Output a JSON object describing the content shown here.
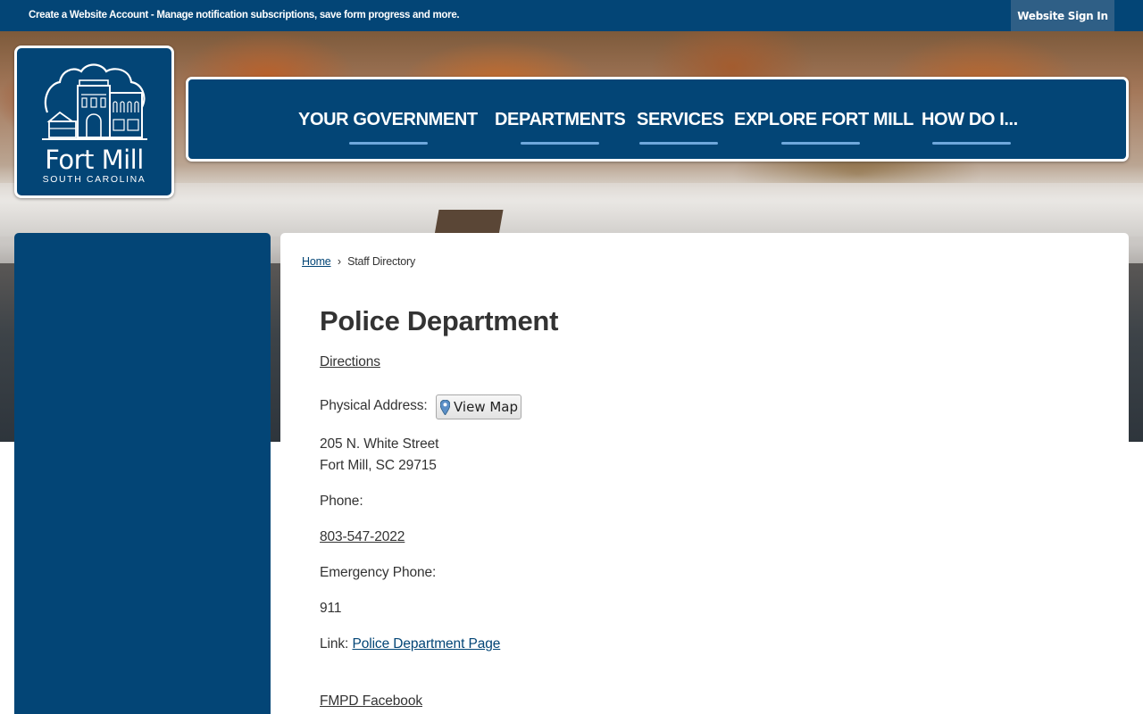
{
  "topbar": {
    "message": "Create a Website Account - Manage notification subscriptions, save form progress and more.",
    "signin_label": "Website Sign In"
  },
  "logo": {
    "name": "Fort Mill",
    "subtitle": "SOUTH CAROLINA"
  },
  "nav": {
    "items": [
      {
        "label": "YOUR GOVERNMENT"
      },
      {
        "label": "DEPARTMENTS"
      },
      {
        "label": "SERVICES"
      },
      {
        "label": "EXPLORE FORT MILL"
      },
      {
        "label": "HOW DO I..."
      }
    ]
  },
  "breadcrumb": {
    "home": "Home",
    "separator": "›",
    "current": "Staff Directory"
  },
  "main": {
    "title": "Police Department",
    "directions_label": "Directions",
    "physical_address_label": "Physical Address:",
    "view_map_label": "View Map",
    "address_line1": "205 N. White Street",
    "address_line2": "Fort Mill, SC 29715",
    "phone_label": "Phone:",
    "phone_value": "803-547-2022",
    "emergency_label": "Emergency Phone:",
    "emergency_value": "911",
    "link_label": "Link:",
    "link_text": "Police Department Page",
    "facebook_text": "FMPD Facebook"
  },
  "colors": {
    "brand_blue": "#034576",
    "nav_underline": "#6fa8dc",
    "link": "#034576",
    "text": "#333333"
  }
}
